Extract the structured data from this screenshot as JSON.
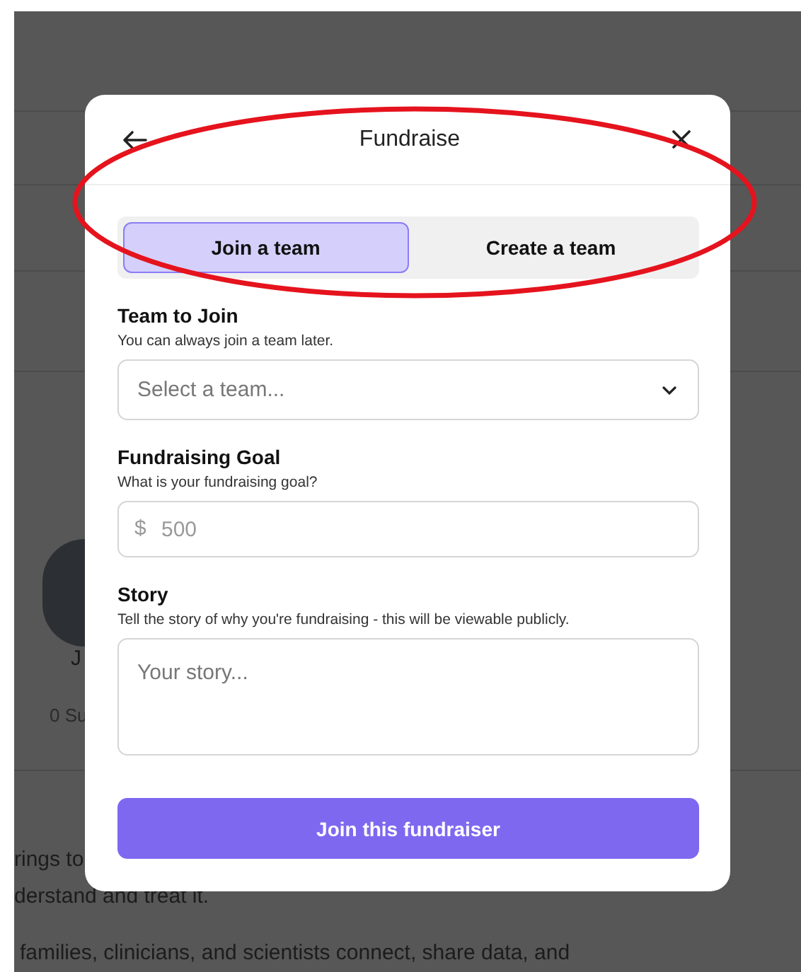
{
  "background_page": {
    "name_fragment": "J",
    "supporters_fragment": "0 Su",
    "paragraph_lines": [
      "rings to",
      "derstand and treat it.",
      "families, clinicians, and scientists connect, share data, and"
    ]
  },
  "modal": {
    "title": "Fundraise",
    "tabs": [
      {
        "label": "Join a team",
        "selected": true
      },
      {
        "label": "Create a team",
        "selected": false
      }
    ],
    "fields": [
      {
        "kind": "select",
        "label": "Team to Join",
        "hint": "You can always join a team later.",
        "placeholder": "Select a team..."
      },
      {
        "kind": "money",
        "label": "Fundraising Goal",
        "hint": "What is your fundraising goal?",
        "prefix": "$",
        "placeholder": "500"
      },
      {
        "kind": "textarea",
        "label": "Story",
        "hint": "Tell the story of why you're fundraising - this will be viewable publicly.",
        "placeholder": "Your story..."
      }
    ],
    "submit_button": "Join this fundraiser"
  }
}
